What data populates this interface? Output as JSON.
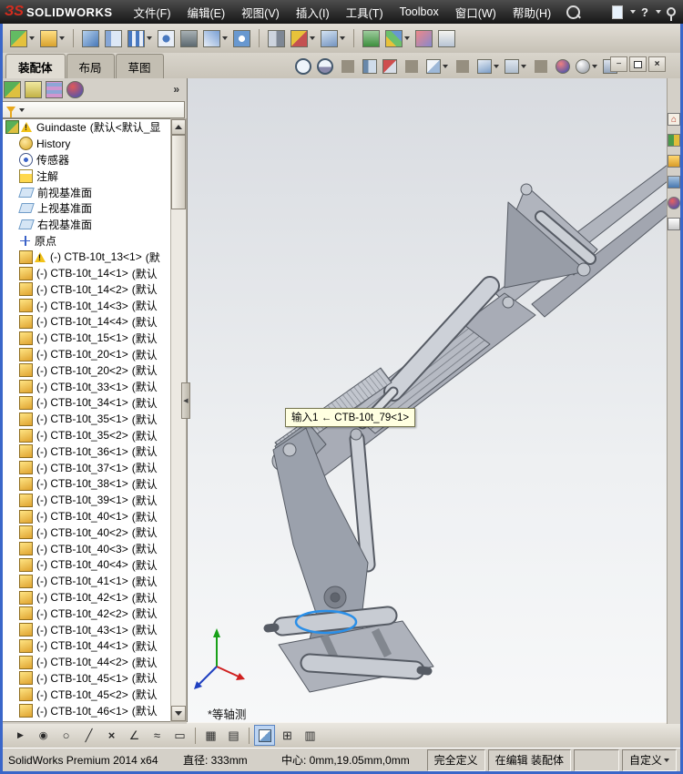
{
  "titlebar": {
    "brand_mark": "ЗS",
    "brand": "SOLIDWORKS",
    "menus": [
      "文件(F)",
      "编辑(E)",
      "视图(V)",
      "插入(I)",
      "工具(T)",
      "Toolbox",
      "窗口(W)",
      "帮助(H)"
    ],
    "help_label": "?"
  },
  "command_tabs": [
    {
      "label": "装配体",
      "active": true
    },
    {
      "label": "布局",
      "active": false
    },
    {
      "label": "草图",
      "active": false
    }
  ],
  "main_toolbar": {
    "buttons": [
      {
        "icon": "insert-component",
        "caret": true
      },
      {
        "icon": "open-folder",
        "caret": true
      },
      {
        "icon": "separator"
      },
      {
        "icon": "edit-component"
      },
      {
        "icon": "mate"
      },
      {
        "icon": "linear-pattern",
        "caret": true
      },
      {
        "icon": "circular-pattern"
      },
      {
        "icon": "smart-fasteners"
      },
      {
        "icon": "move-component",
        "caret": true
      },
      {
        "icon": "rotate-component"
      },
      {
        "icon": "separator"
      },
      {
        "icon": "show-hidden"
      },
      {
        "icon": "assembly-features",
        "caret": true
      },
      {
        "icon": "reference-geometry",
        "caret": true
      },
      {
        "icon": "separator"
      },
      {
        "icon": "motion-study"
      },
      {
        "icon": "exploded-view",
        "caret": true
      },
      {
        "icon": "interference-detection"
      },
      {
        "icon": "instant3d"
      }
    ]
  },
  "view_toolbar": {
    "buttons": [
      {
        "icon": "zoom-fit"
      },
      {
        "icon": "zoom-area"
      },
      {
        "icon": "separator"
      },
      {
        "icon": "previous-view"
      },
      {
        "icon": "section-view"
      },
      {
        "icon": "separator"
      },
      {
        "icon": "view-orientation",
        "caret": true
      },
      {
        "icon": "separator"
      },
      {
        "icon": "display-style",
        "caret": true
      },
      {
        "icon": "hide-show",
        "caret": true
      },
      {
        "icon": "separator"
      },
      {
        "icon": "edit-appearance"
      },
      {
        "icon": "apply-scene",
        "caret": true
      },
      {
        "icon": "view-settings",
        "caret": true
      }
    ]
  },
  "doc_window_buttons": [
    {
      "icon": "minimize"
    },
    {
      "icon": "restore"
    },
    {
      "icon": "close"
    }
  ],
  "panel": {
    "expand_label": "»",
    "tabs": [
      {
        "icon": "featuremanager"
      },
      {
        "icon": "propertymanager"
      },
      {
        "icon": "configurationmanager"
      },
      {
        "icon": "displaymanager"
      }
    ]
  },
  "feature_tree": {
    "root": {
      "name": "Guindaste",
      "config": "(默认<默认_显"
    },
    "items": [
      {
        "name": "History",
        "icon": "history"
      },
      {
        "name": "传感器",
        "icon": "sensor"
      },
      {
        "name": "注解",
        "icon": "note"
      },
      {
        "name": "前视基准面",
        "icon": "plane"
      },
      {
        "name": "上视基准面",
        "icon": "plane"
      },
      {
        "name": "右视基准面",
        "icon": "plane"
      },
      {
        "name": "原点",
        "icon": "origin"
      },
      {
        "name": "(-) CTB-10t_13<1>",
        "config": "(默",
        "icon": "part",
        "warning": true
      },
      {
        "name": "(-) CTB-10t_14<1>",
        "config": "(默认",
        "icon": "part"
      },
      {
        "name": "(-) CTB-10t_14<2>",
        "config": "(默认",
        "icon": "part"
      },
      {
        "name": "(-) CTB-10t_14<3>",
        "config": "(默认",
        "icon": "part"
      },
      {
        "name": "(-) CTB-10t_14<4>",
        "config": "(默认",
        "icon": "part"
      },
      {
        "name": "(-) CTB-10t_15<1>",
        "config": "(默认",
        "icon": "part"
      },
      {
        "name": "(-) CTB-10t_20<1>",
        "config": "(默认",
        "icon": "part"
      },
      {
        "name": "(-) CTB-10t_20<2>",
        "config": "(默认",
        "icon": "part"
      },
      {
        "name": "(-) CTB-10t_33<1>",
        "config": "(默认",
        "icon": "part"
      },
      {
        "name": "(-) CTB-10t_34<1>",
        "config": "(默认",
        "icon": "part"
      },
      {
        "name": "(-) CTB-10t_35<1>",
        "config": "(默认",
        "icon": "part"
      },
      {
        "name": "(-) CTB-10t_35<2>",
        "config": "(默认",
        "icon": "part"
      },
      {
        "name": "(-) CTB-10t_36<1>",
        "config": "(默认",
        "icon": "part"
      },
      {
        "name": "(-) CTB-10t_37<1>",
        "config": "(默认",
        "icon": "part"
      },
      {
        "name": "(-) CTB-10t_38<1>",
        "config": "(默认",
        "icon": "part"
      },
      {
        "name": "(-) CTB-10t_39<1>",
        "config": "(默认",
        "icon": "part"
      },
      {
        "name": "(-) CTB-10t_40<1>",
        "config": "(默认",
        "icon": "part"
      },
      {
        "name": "(-) CTB-10t_40<2>",
        "config": "(默认",
        "icon": "part"
      },
      {
        "name": "(-) CTB-10t_40<3>",
        "config": "(默认",
        "icon": "part"
      },
      {
        "name": "(-) CTB-10t_40<4>",
        "config": "(默认",
        "icon": "part"
      },
      {
        "name": "(-) CTB-10t_41<1>",
        "config": "(默认",
        "icon": "part"
      },
      {
        "name": "(-) CTB-10t_42<1>",
        "config": "(默认",
        "icon": "part"
      },
      {
        "name": "(-) CTB-10t_42<2>",
        "config": "(默认",
        "icon": "part"
      },
      {
        "name": "(-) CTB-10t_43<1>",
        "config": "(默认",
        "icon": "part"
      },
      {
        "name": "(-) CTB-10t_44<1>",
        "config": "(默认",
        "icon": "part"
      },
      {
        "name": "(-) CTB-10t_44<2>",
        "config": "(默认",
        "icon": "part"
      },
      {
        "name": "(-) CTB-10t_45<1>",
        "config": "(默认",
        "icon": "part"
      },
      {
        "name": "(-) CTB-10t_45<2>",
        "config": "(默认",
        "icon": "part"
      },
      {
        "name": "(-) CTB-10t_46<1>",
        "config": "(默认",
        "icon": "part"
      }
    ]
  },
  "viewport": {
    "tooltip": "输入1 ← CTB-10t_79<1>",
    "view_label": "*等轴测",
    "highlight_color": "#2a8fe8"
  },
  "task_pane": {
    "tabs": [
      {
        "icon": "home"
      },
      {
        "icon": "design-library"
      },
      {
        "icon": "file-explorer"
      },
      {
        "icon": "view-palette"
      },
      {
        "icon": "appearances"
      },
      {
        "icon": "custom-properties"
      }
    ]
  },
  "bottom_toolbar": {
    "buttons": [
      {
        "icon": "select"
      },
      {
        "icon": "point"
      },
      {
        "icon": "circle"
      },
      {
        "icon": "line"
      },
      {
        "icon": "cross"
      },
      {
        "icon": "angle"
      },
      {
        "icon": "spline"
      },
      {
        "icon": "rectangle"
      },
      {
        "icon": "separator"
      },
      {
        "icon": "grid"
      },
      {
        "icon": "hatch"
      },
      {
        "icon": "separator"
      },
      {
        "icon": "shaded-cube-pressed"
      },
      {
        "icon": "quad-view"
      },
      {
        "icon": "table"
      }
    ]
  },
  "statusbar": {
    "app": "SolidWorks Premium 2014 x64",
    "diameter": "直径: 333mm",
    "center": "中心: 0mm,19.05mm,0mm",
    "defined": "完全定义",
    "editing": "在编辑 装配体",
    "custom": "自定义"
  }
}
